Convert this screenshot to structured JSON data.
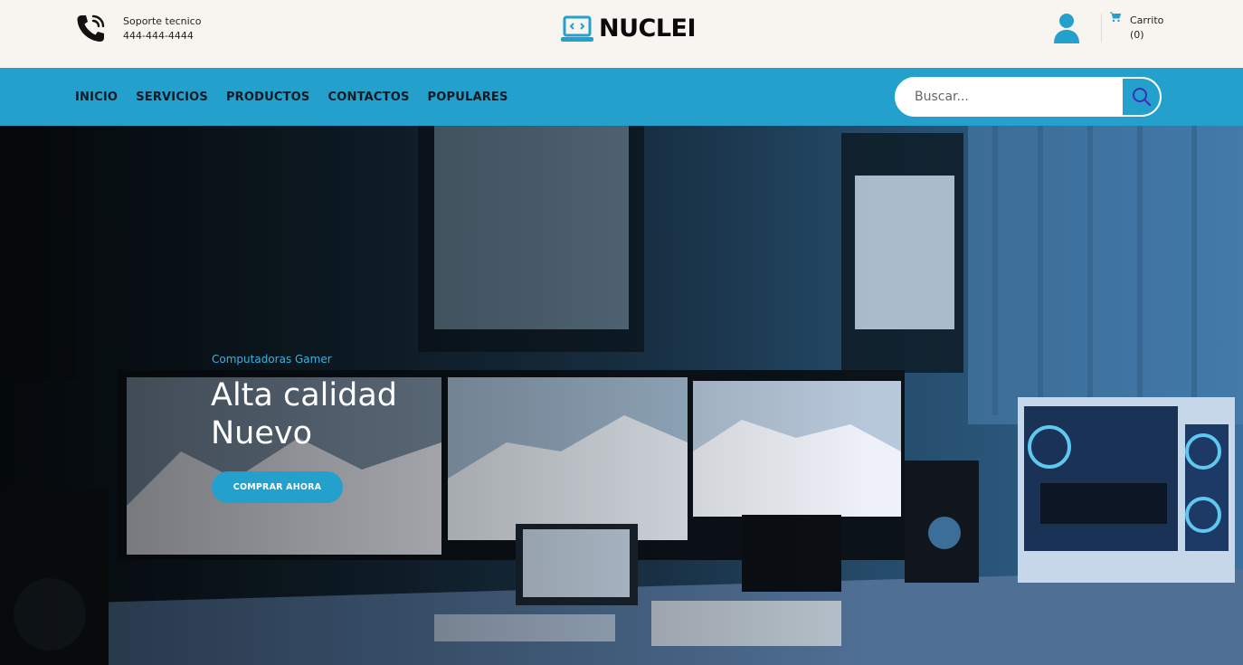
{
  "header": {
    "support_title": "Soporte tecnico",
    "support_phone": "444-444-4444",
    "logo_text": "NUCLEI",
    "cart_label": "Carrito",
    "cart_count": "(0)"
  },
  "nav": {
    "items": [
      "INICIO",
      "SERVICIOS",
      "PRODUCTOS",
      "CONTACTOS",
      "POPULARES"
    ]
  },
  "search": {
    "placeholder": "Buscar..."
  },
  "hero": {
    "subtitle": "Computadoras Gamer",
    "title_line1": "Alta calidad",
    "title_line2": "Nuevo",
    "cta_label": "COMPRAR AHORA"
  },
  "icons": {
    "phone": "phone-icon",
    "logo": "laptop-code-icon",
    "user": "user-icon",
    "cart": "cart-icon",
    "search": "search-icon"
  },
  "colors": {
    "accent": "#23a0cc",
    "header_bg": "#f8f5f0"
  }
}
